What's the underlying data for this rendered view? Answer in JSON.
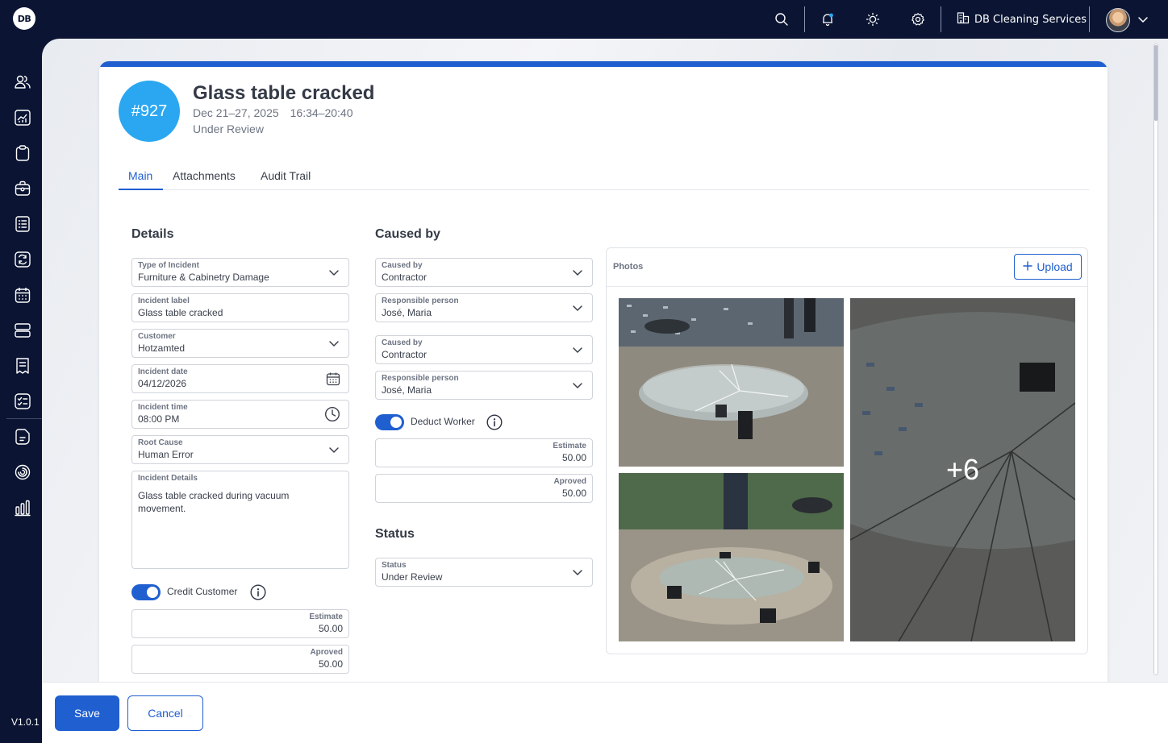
{
  "app": {
    "logo": "DB",
    "version": "V1.0.1"
  },
  "topbar": {
    "icons": [
      "search-icon",
      "bell-icon",
      "sun-icon",
      "gear-icon"
    ],
    "company": "DB Cleaning Services",
    "accent": "#1f5fd0"
  },
  "sidebar": {
    "items": [
      "users-icon",
      "analytics-icon",
      "clipboard-icon",
      "briefcase-icon",
      "list-icon",
      "sync-icon",
      "calendar-icon",
      "server-icon",
      "receipt-icon",
      "checklist-icon",
      "document-icon",
      "spinner-icon",
      "bar-chart-icon"
    ]
  },
  "incident": {
    "number": "#927",
    "title": "Glass table cracked",
    "date_range": "Dec 21–27, 2025",
    "time_range": "16:34–20:40",
    "status": "Under Review"
  },
  "tabs": [
    "Main",
    "Attachments",
    "Audit Trail"
  ],
  "details": {
    "title": "Details",
    "type_label": "Type of Incident",
    "type_value": "Furniture & Cabinetry Damage",
    "incident_label_label": "Incident label",
    "incident_label_value": "Glass table cracked",
    "customer_label": "Customer",
    "customer_value": "Hotzamted",
    "date_label": "Incident date",
    "date_value": "04/12/2026",
    "time_label": "Incident time",
    "time_value": "08:00 PM",
    "root_cause_label": "Root Cause",
    "root_cause_value": "Human Error",
    "details_label": "Incident Details",
    "details_value": "Glass table cracked during vacuum movement.",
    "credit_toggle_label": "Credit Customer",
    "credit_toggle_on": true,
    "estimate_label": "Estimate",
    "estimate_value": "50.00",
    "approved_label": "Aproved",
    "approved_value": "50.00"
  },
  "caused_by": {
    "title": "Caused by",
    "entries": [
      {
        "caused_label": "Caused by",
        "caused_value": "Contractor",
        "person_label": "Responsible person",
        "person_value": "José, Maria"
      },
      {
        "caused_label": "Caused by",
        "caused_value": "Contractor",
        "person_label": "Responsible person",
        "person_value": "José, Maria"
      }
    ],
    "deduct_toggle_label": "Deduct Worker",
    "deduct_toggle_on": true,
    "estimate_label": "Estimate",
    "estimate_value": "50.00",
    "approved_label": "Aproved",
    "approved_value": "50.00"
  },
  "status_section": {
    "title": "Status",
    "label": "Status",
    "value": "Under Review"
  },
  "photos": {
    "title": "Photos",
    "upload_label": "Upload",
    "more_count": "+6"
  },
  "footer": {
    "save_label": "Save",
    "cancel_label": "Cancel"
  }
}
